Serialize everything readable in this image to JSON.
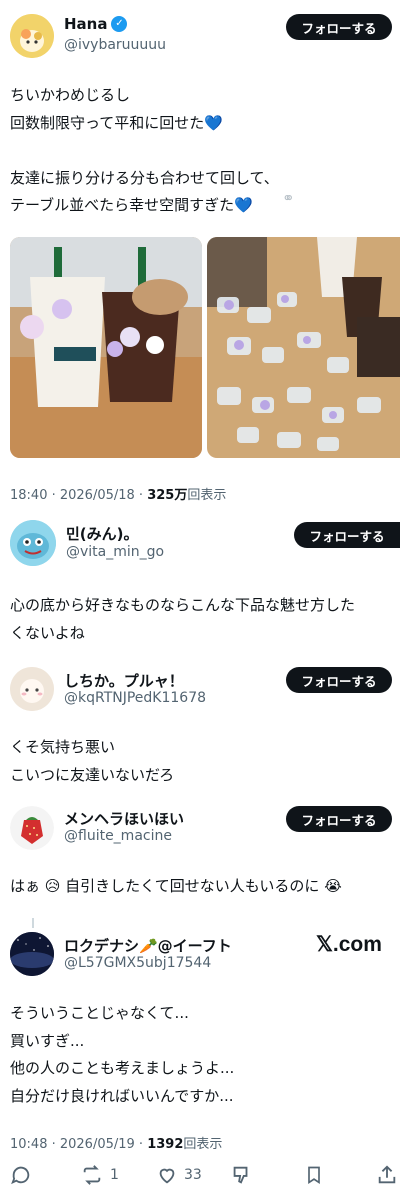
{
  "main_post": {
    "name": "Hana",
    "handle": "@ivybaruuuuu",
    "follow_label": "フォローする",
    "text": "ちいかわめじるし\n回数制限守って平和に回せた💙\n\n友達に振り分ける分も合わせて回して、\nテーブル並べたら幸せ空間すぎた💙",
    "timestamp": "18:40 · 2026/05/18 · ",
    "views_count": "325万",
    "views_label": "回表示"
  },
  "replies": [
    {
      "name": "민(みん)。",
      "handle": "@vita_min_go",
      "follow_label": "フォローする",
      "text": "心の底から好きなものならこんな下品な魅せ方した\nくないよね"
    },
    {
      "name": "しちか。プルャ！",
      "handle": "@kqRTNJPedK11678",
      "follow_label": "フォローする",
      "text": "くそ気持ち悪い\nこいつに友達いないだろ"
    },
    {
      "name": "メンヘラほいほい",
      "handle": "@fluite_macine",
      "follow_label": "フォローする",
      "text": "はぁ 😥 自引きしたくて回せない人もいるのに 😭"
    },
    {
      "name": "ロクデナシ🥕@イーフト",
      "handle": "@L57GMX5ubj17544",
      "text": "そういうことじゃなくて...\n買いすぎ...\n他の人のことも考えましょうよ...\n自分だけ良ければいいんですか...",
      "timestamp": "10:48 · 2026/05/19 · ",
      "views_count": "1392",
      "views_label": "回表示"
    }
  ],
  "watermark": "𝕏.com",
  "actions": {
    "reply_icon": "reply-icon",
    "retweet_count": "1",
    "like_count": "33",
    "dislike_icon": "dislike-icon",
    "bookmark_icon": "bookmark-icon",
    "share_icon": "share-icon"
  },
  "colors": {
    "text": "#0f1419",
    "secondary": "#536471",
    "verified": "#1d9bf0",
    "button": "#0f1419"
  }
}
